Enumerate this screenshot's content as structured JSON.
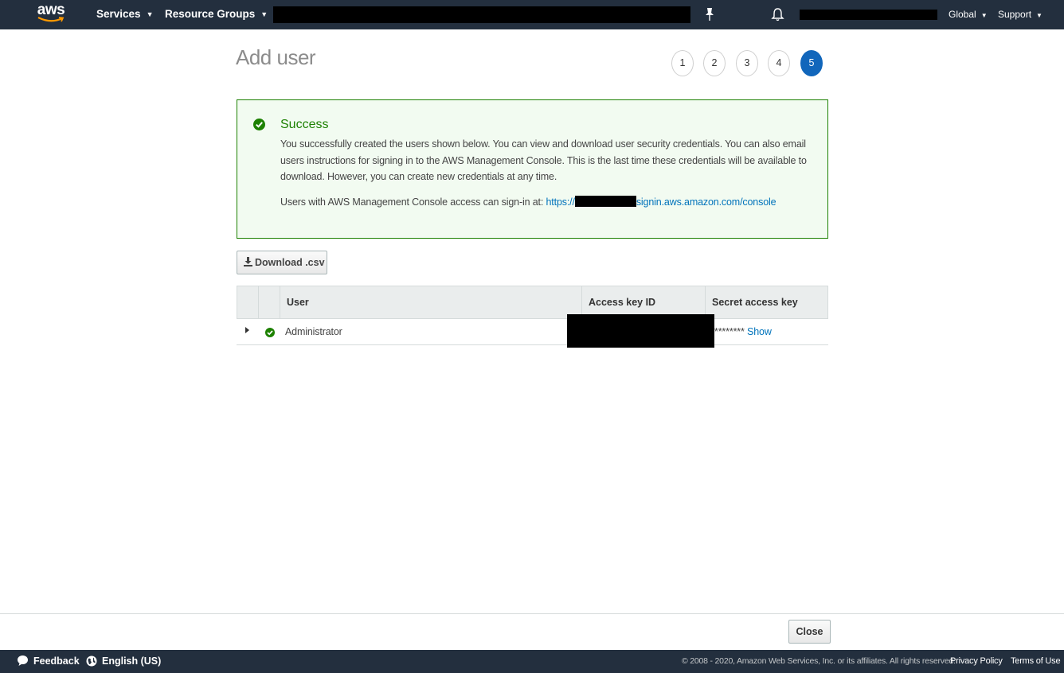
{
  "topnav": {
    "logo_text": "aws",
    "services_label": "Services",
    "resource_groups_label": "Resource Groups",
    "region_label": "Global",
    "support_label": "Support"
  },
  "page": {
    "title": "Add user",
    "steps": [
      "1",
      "2",
      "3",
      "4",
      "5"
    ],
    "active_step": "5"
  },
  "success": {
    "title": "Success",
    "message": "You successfully created the users shown below. You can view and download user security credentials. You can also email users instructions for signing in to the AWS Management Console. This is the last time these credentials will be available to download. However, you can create new credentials at any time.",
    "signin_prefix": "Users with AWS Management Console access can sign-in at: ",
    "signin_link_start": "https://",
    "signin_link_end": "signin.aws.amazon.com/console"
  },
  "download_label": "Download .csv",
  "table": {
    "columns": [
      "User",
      "Access key ID",
      "Secret access key"
    ],
    "rows": [
      {
        "user": "Administrator",
        "secret_masked": "********",
        "show_label": "Show"
      }
    ]
  },
  "close_label": "Close",
  "footer": {
    "feedback_label": "Feedback",
    "language_label": "English (US)",
    "copyright": "© 2008 - 2020, Amazon Web Services, Inc. or its affiliates. All rights reserved.",
    "privacy_label": "Privacy Policy",
    "terms_label": "Terms of Use"
  },
  "colors": {
    "nav_bg": "#232f3e",
    "success_green": "#1d8102",
    "link_blue": "#0073bb",
    "step_active": "#1166bb"
  }
}
